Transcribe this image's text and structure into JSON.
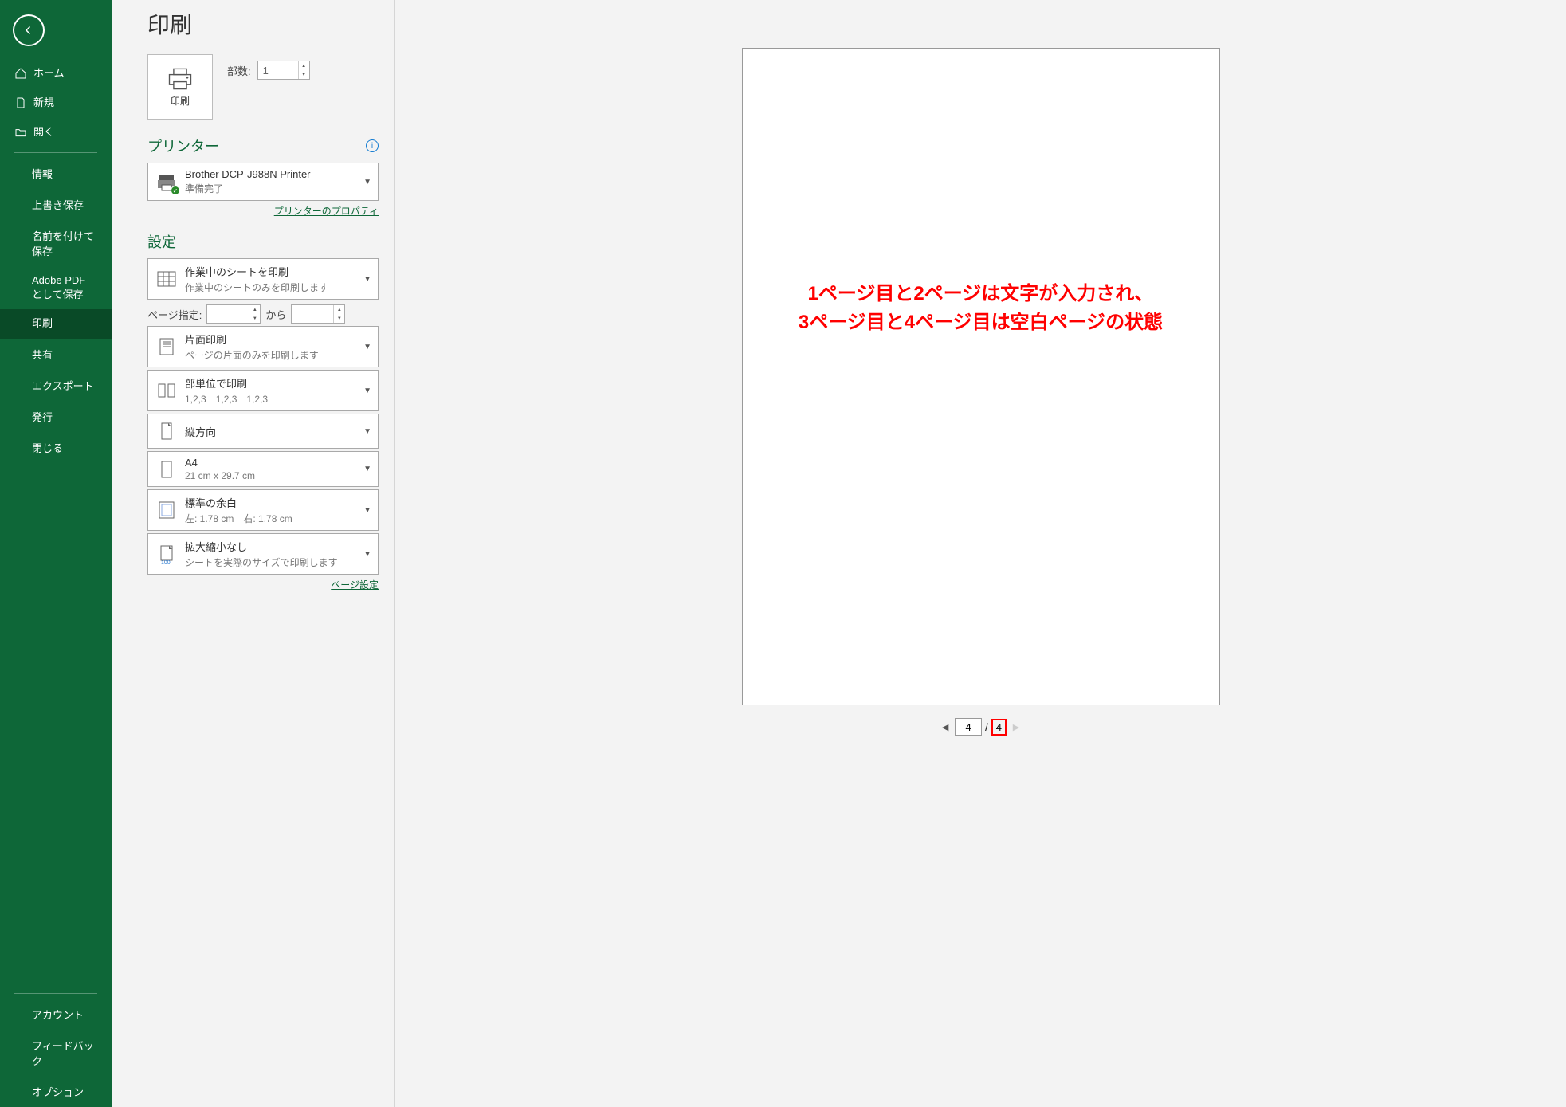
{
  "page_title": "印刷",
  "sidebar": {
    "home": "ホーム",
    "new": "新規",
    "open": "開く",
    "items": [
      "情報",
      "上書き保存",
      "名前を付けて保存",
      "Adobe PDF として保存",
      "印刷",
      "共有",
      "エクスポート",
      "発行",
      "閉じる"
    ],
    "bottom": [
      "アカウント",
      "フィードバック",
      "オプション"
    ]
  },
  "print_tile_label": "印刷",
  "copies_label": "部数:",
  "copies_value": "1",
  "printer_section": "プリンター",
  "printer_name": "Brother DCP-J988N Printer",
  "printer_status": "準備完了",
  "printer_properties_link": "プリンターのプロパティ",
  "settings_section": "設定",
  "setting_what": {
    "title": "作業中のシートを印刷",
    "sub": "作業中のシートのみを印刷します"
  },
  "pages_label": "ページ指定:",
  "pages_to": "から",
  "setting_sides": {
    "title": "片面印刷",
    "sub": "ページの片面のみを印刷します"
  },
  "setting_collate": {
    "title": "部単位で印刷",
    "sub": "1,2,3　1,2,3　1,2,3"
  },
  "setting_orientation": {
    "title": "縦方向"
  },
  "setting_paper": {
    "title": "A4",
    "sub": "21 cm x 29.7 cm"
  },
  "setting_margins": {
    "title": "標準の余白",
    "sub": "左: 1.78 cm　右: 1.78 cm"
  },
  "setting_scaling": {
    "title": "拡大縮小なし",
    "sub": "シートを実際のサイズで印刷します"
  },
  "page_setup_link": "ページ設定",
  "annotation_line1": "1ページ目と2ページは文字が入力され、",
  "annotation_line2": "3ページ目と4ページ目は空白ページの状態",
  "page_nav": {
    "current": "4",
    "slash": "/",
    "total": "4"
  }
}
